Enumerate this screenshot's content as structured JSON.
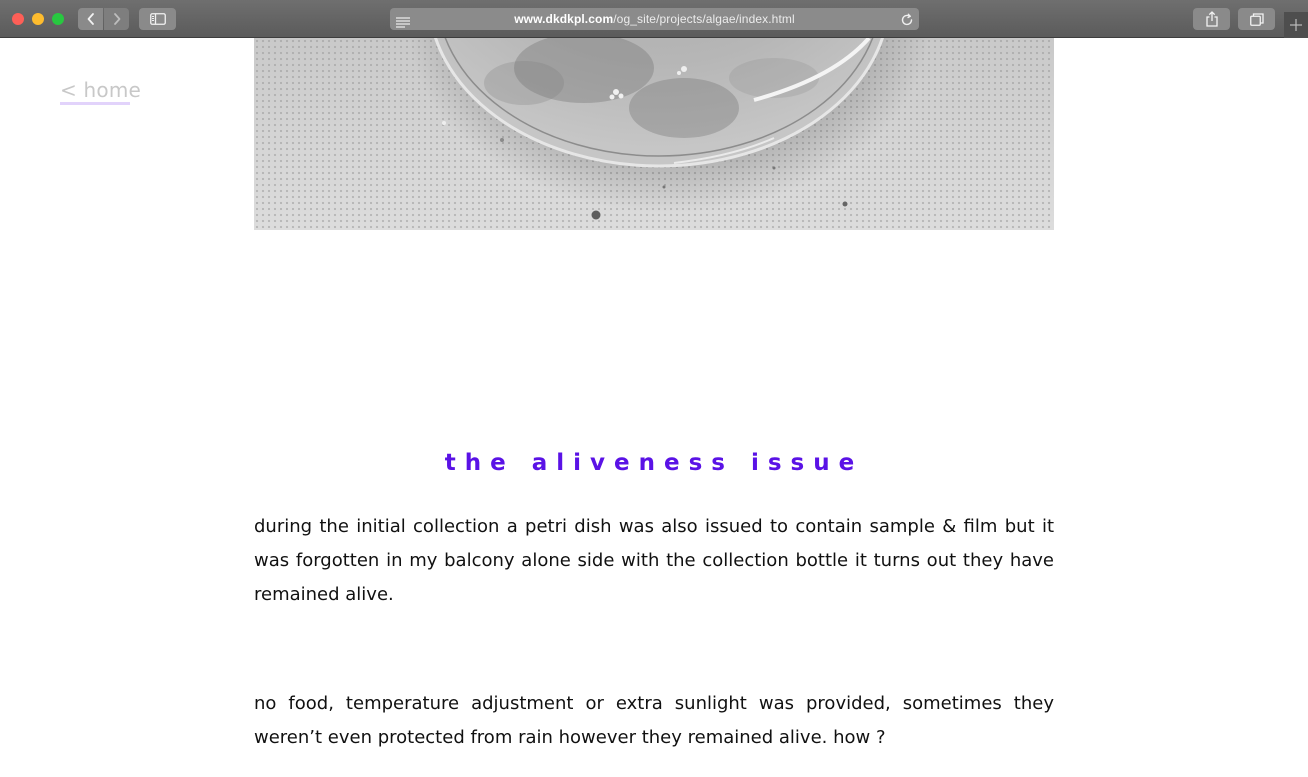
{
  "browser": {
    "url_host": "www.dkdkpl.com",
    "url_path": "/og_site/projects/algae/index.html",
    "icons": {
      "back": "chevron-left-icon",
      "forward": "chevron-right-icon",
      "sidebar": "sidebar-icon",
      "reader": "reader-icon",
      "reload": "reload-icon",
      "share": "share-icon",
      "tabs": "tabs-overview-icon",
      "new_tab": "plus-icon"
    }
  },
  "page": {
    "home_link": "< home",
    "heading": "the aliveness issue",
    "paragraphs": [
      "during the initial collection a petri dish was also issued to contain sample & film but it was forgotten in my balcony alone side with the collection bottle it turns out they have remained alive.",
      "no food, temperature adjustment or extra sunlight was provided, sometimes they weren’t even protected from rain however they remained alive. how ?"
    ]
  },
  "colors": {
    "heading": "#5a12e6",
    "home_link": "#c8c8c8",
    "home_underline": "#e2d3fb",
    "body_text": "#111111"
  }
}
